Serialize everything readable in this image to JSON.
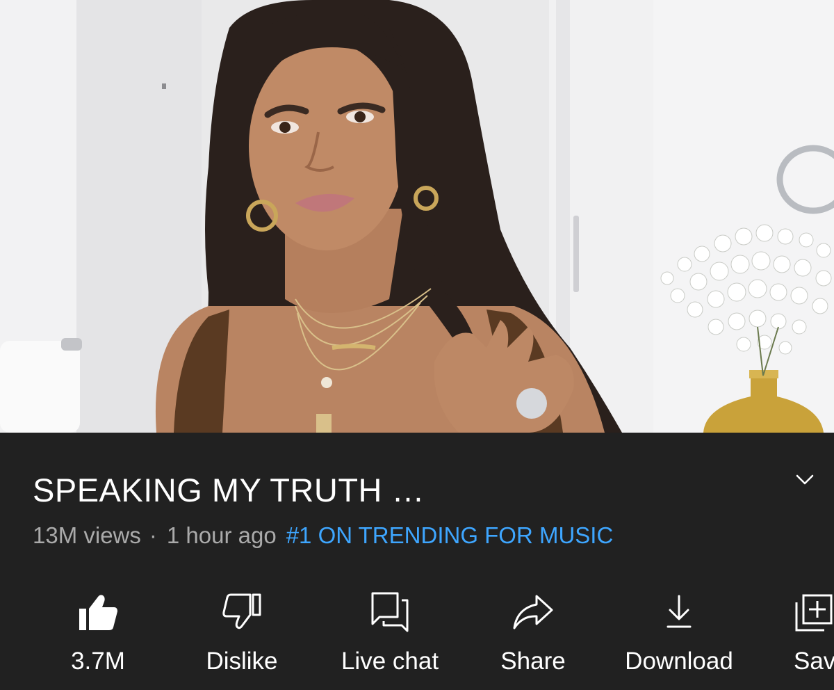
{
  "video": {
    "title": "SPEAKING MY TRUTH …",
    "views": "13M views",
    "separator": "·",
    "time_ago": "1 hour ago",
    "trending": "#1 ON TRENDING FOR MUSIC"
  },
  "actions": {
    "like": {
      "label": "3.7M",
      "icon": "thumbs-up-filled-icon"
    },
    "dislike": {
      "label": "Dislike",
      "icon": "thumbs-down-outline-icon"
    },
    "live_chat": {
      "label": "Live chat",
      "icon": "chat-icon"
    },
    "share": {
      "label": "Share",
      "icon": "share-arrow-icon"
    },
    "download": {
      "label": "Download",
      "icon": "download-icon"
    },
    "save": {
      "label": "Sav",
      "icon": "add-to-playlist-icon"
    }
  },
  "colors": {
    "background": "#212121",
    "title": "#ffffff",
    "meta": "#aaaaaa",
    "trending_link": "#3ea6ff"
  }
}
